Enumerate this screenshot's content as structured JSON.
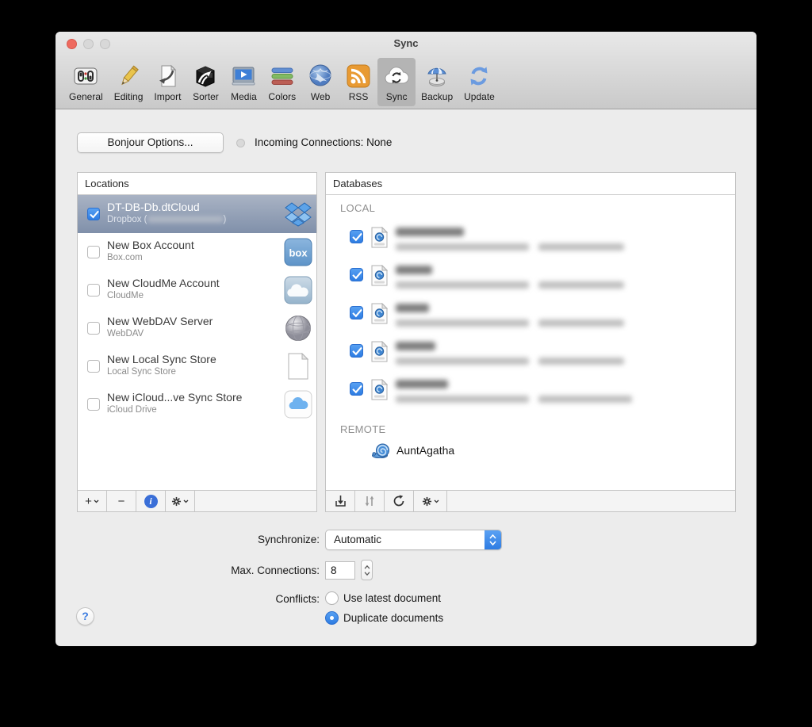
{
  "window": {
    "title": "Sync"
  },
  "toolbar": {
    "items": [
      {
        "label": "General",
        "icon": "general-icon",
        "selected": false
      },
      {
        "label": "Editing",
        "icon": "editing-icon",
        "selected": false
      },
      {
        "label": "Import",
        "icon": "import-icon",
        "selected": false
      },
      {
        "label": "Sorter",
        "icon": "sorter-icon",
        "selected": false
      },
      {
        "label": "Media",
        "icon": "media-icon",
        "selected": false
      },
      {
        "label": "Colors",
        "icon": "colors-icon",
        "selected": false
      },
      {
        "label": "Web",
        "icon": "web-icon",
        "selected": false
      },
      {
        "label": "RSS",
        "icon": "rss-icon",
        "selected": false
      },
      {
        "label": "Sync",
        "icon": "sync-icon",
        "selected": true
      },
      {
        "label": "Backup",
        "icon": "backup-icon",
        "selected": false
      },
      {
        "label": "Update",
        "icon": "update-icon",
        "selected": false
      }
    ]
  },
  "bonjour": {
    "button_label": "Bonjour Options...",
    "status_label": "Incoming Connections: None",
    "status_dot_color": "#d9d9d9"
  },
  "locations": {
    "header": "Locations",
    "items": [
      {
        "name": "DT-DB-Db.dtCloud",
        "detail_prefix": "Dropbox (",
        "detail_suffix": ")",
        "detail_redacted": true,
        "checked": true,
        "selected": true,
        "icon": "dropbox-icon"
      },
      {
        "name": "New Box Account",
        "detail": "Box.com",
        "checked": false,
        "selected": false,
        "icon": "box-icon",
        "icon_text": "box"
      },
      {
        "name": "New CloudMe Account",
        "detail": "CloudMe",
        "checked": false,
        "selected": false,
        "icon": "cloudme-icon"
      },
      {
        "name": "New WebDAV Server",
        "detail": "WebDAV",
        "checked": false,
        "selected": false,
        "icon": "webdav-globe-icon"
      },
      {
        "name": "New Local Sync Store",
        "detail": "Local Sync Store",
        "checked": false,
        "selected": false,
        "icon": "document-icon"
      },
      {
        "name": "New iCloud...ve Sync Store",
        "detail": "iCloud Drive",
        "checked": false,
        "selected": false,
        "icon": "icloud-drive-icon"
      }
    ],
    "toolbar": {
      "add_label": "+",
      "remove_label": "−",
      "info_label": "i"
    }
  },
  "databases": {
    "header": "Databases",
    "local_section_label": "LOCAL",
    "remote_section_label": "REMOTE",
    "local_rows": [
      {
        "redacted": true,
        "checked": true
      },
      {
        "redacted": true,
        "checked": true
      },
      {
        "redacted": true,
        "checked": true
      },
      {
        "redacted": true,
        "checked": true
      },
      {
        "redacted": true,
        "checked": true
      }
    ],
    "remote_rows": [
      {
        "name": "AuntAgatha",
        "icon": "devonthink-snail-icon"
      }
    ]
  },
  "settings": {
    "synchronize_label": "Synchronize:",
    "synchronize_value": "Automatic",
    "max_connections_label": "Max. Connections:",
    "max_connections_value": "8",
    "conflicts_label": "Conflicts:",
    "conflicts_options": [
      {
        "label": "Use latest document",
        "selected": false
      },
      {
        "label": "Duplicate documents",
        "selected": true
      }
    ]
  },
  "help": {
    "label": "?"
  },
  "colors": {
    "accent_blue": "#3f87e0",
    "selected_row_top": "#a9b3c4",
    "selected_row_bottom": "#8090aa",
    "rss_orange": "#e89a33"
  }
}
